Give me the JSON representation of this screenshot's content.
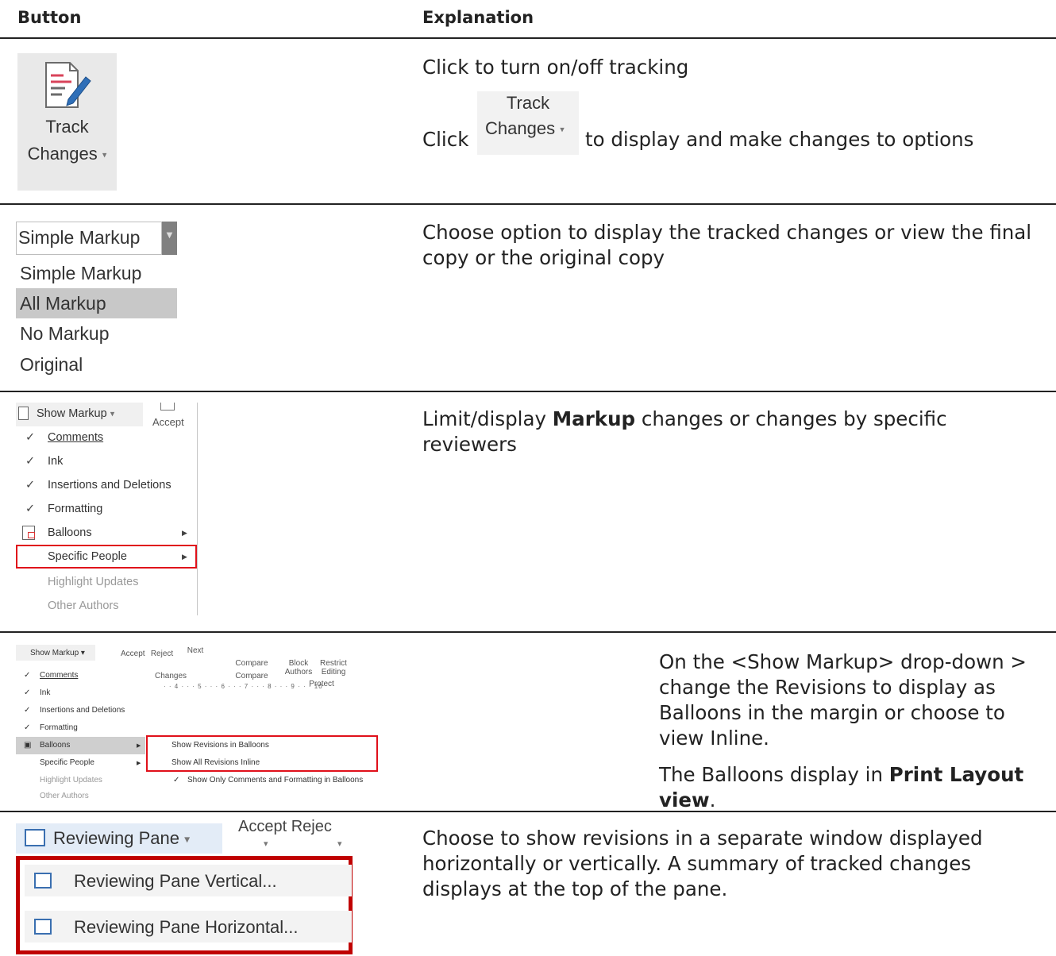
{
  "header": {
    "button_col": "Button",
    "explanation_col": "Explanation"
  },
  "rows": [
    {
      "ui": {
        "line1": "Track",
        "line2": "Changes",
        "inline_line1": "Track",
        "inline_line2": "Changes"
      },
      "text1": "Click to turn on/off tracking",
      "text2_pre": "Click",
      "text2_post": "to display and make changes to options"
    },
    {
      "ui": {
        "current": "Simple Markup",
        "options": [
          "Simple Markup",
          "All Markup",
          "No Markup",
          "Original"
        ]
      },
      "text_pre": "Choose option to display the tracked changes or view the final copy or the original copy"
    },
    {
      "ui": {
        "head": "Show Markup",
        "side": "Accept",
        "items": [
          "Comments",
          "Ink",
          "Insertions and Deletions",
          "Formatting",
          "Balloons",
          "Specific People",
          "Highlight Updates",
          "Other Authors"
        ]
      },
      "text_pre": "Limit/display",
      "text_bold": "Markup",
      "text_post": "changes or changes by specific reviewers"
    },
    {
      "ui": {
        "head": "Show Markup",
        "items": [
          "Comments",
          "Ink",
          "Insertions and Deletions",
          "Formatting",
          "Balloons",
          "Specific People",
          "Highlight Updates",
          "Other Authors"
        ],
        "sub": [
          "Show Revisions in Balloons",
          "Show All Revisions Inline",
          "Show Only Comments and Formatting in Balloons"
        ],
        "ribbon": {
          "accept": "Accept",
          "reject": "Reject",
          "next": "Next",
          "changes": "Changes",
          "compare": "Compare",
          "compare_group": "Compare",
          "block": "Block",
          "authors": "Authors",
          "restrict": "Restrict",
          "editing": "Editing",
          "protect": "Protect"
        },
        "ruler": "· · 4 · · · 5 · · · 6 · · · 7 · · · 8 · · · 9 · · · 10"
      },
      "text1": "On the <Show Markup> drop-down > change the Revisions to display as Balloons in the margin or choose to view Inline.",
      "text2_pre": "The Balloons display in",
      "text2_bold": "Print Layout view",
      "text2_post": "."
    },
    {
      "ui": {
        "head": "Reviewing Pane",
        "side": "Accept Rejec",
        "items": [
          "Reviewing Pane Vertical...",
          "Reviewing Pane Horizontal..."
        ]
      },
      "text": "Choose to show revisions in a separate window displayed horizontally or vertically. A summary of tracked changes displays at the top of the pane."
    }
  ]
}
